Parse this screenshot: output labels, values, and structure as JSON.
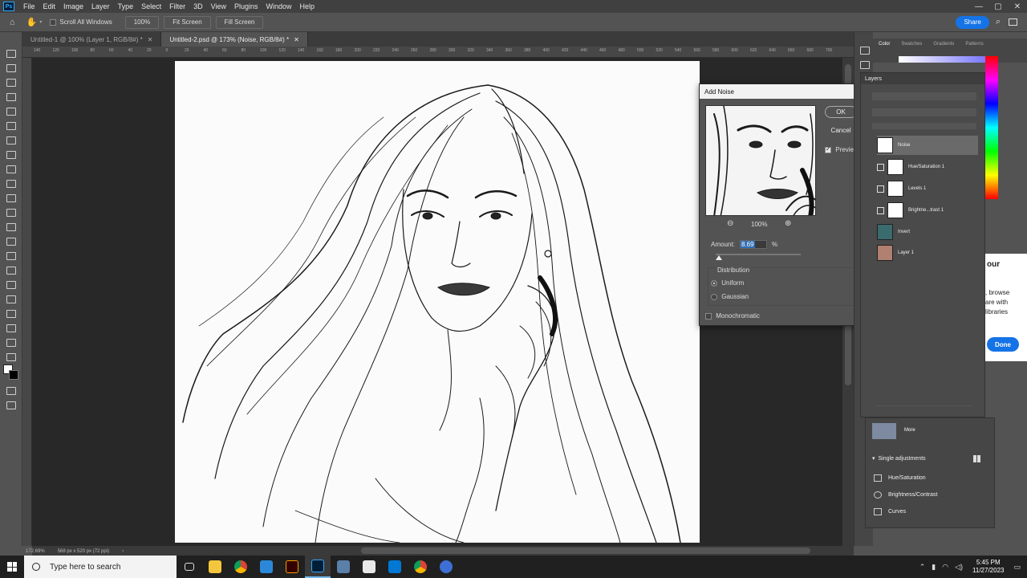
{
  "app": {
    "menu": [
      "File",
      "Edit",
      "Image",
      "Layer",
      "Type",
      "Select",
      "Filter",
      "3D",
      "View",
      "Plugins",
      "Window",
      "Help"
    ],
    "logo": "Ps"
  },
  "options": {
    "scroll_all": "Scroll All Windows",
    "zoom": "100%",
    "fit_screen": "Fit Screen",
    "fill_screen": "Fill Screen",
    "share": "Share"
  },
  "tabs": [
    {
      "label": "Untitled-1 @ 100% (Layer 1, RGB/8#) *"
    },
    {
      "label": "Untitled-2.psd @ 173% (Noise, RGB/8#) *"
    }
  ],
  "ruler_ticks": [
    "140",
    "120",
    "100",
    "80",
    "60",
    "40",
    "20",
    "0",
    "20",
    "40",
    "60",
    "80",
    "100",
    "120",
    "140",
    "160",
    "180",
    "200",
    "220",
    "240",
    "260",
    "280",
    "300",
    "320",
    "340",
    "360",
    "380",
    "400",
    "420",
    "440",
    "460",
    "480",
    "500",
    "520",
    "540",
    "560",
    "580",
    "600",
    "620",
    "640",
    "660",
    "680",
    "700"
  ],
  "status": {
    "zoom": "172.69%",
    "dimensions": "568 px x 520 px (72 ppi)"
  },
  "dialog": {
    "title": "Add Noise",
    "ok": "OK",
    "cancel": "Cancel",
    "preview_label": "Preview",
    "preview_checked": true,
    "zoom": "100%",
    "amount_label": "Amount:",
    "amount_value": "8.69",
    "amount_unit": "%",
    "distribution_label": "Distribution",
    "uniform": "Uniform",
    "gaussian": "Gaussian",
    "distribution_selected": "Uniform",
    "monochromatic": "Monochromatic",
    "monochromatic_checked": false
  },
  "color_panel": {
    "tabs": [
      "Color",
      "Swatches",
      "Gradients",
      "Patterns"
    ]
  },
  "layers_panel": {
    "title": "Layers",
    "layers": [
      {
        "name": "Noise",
        "selected": true
      },
      {
        "name": "Hue/Saturation 1",
        "selected": false
      },
      {
        "name": "Levels 1",
        "selected": false
      },
      {
        "name": "Brightne...trast 1",
        "selected": false
      },
      {
        "name": "Invert",
        "selected": false
      },
      {
        "name": "Layer 1",
        "selected": false
      }
    ]
  },
  "properties": {
    "more": "More",
    "section": "Single adjustments",
    "items": [
      "Hue/Saturation",
      "Brightness/Contrast",
      "Curves"
    ]
  },
  "learn_popup": {
    "title_fragment": "our",
    "line1": ", browse",
    "line2": "are with",
    "line3": "libraries",
    "done": "Done"
  },
  "taskbar": {
    "search_placeholder": "Type here to search",
    "time": "5:45 PM",
    "date": "11/27/2023"
  }
}
